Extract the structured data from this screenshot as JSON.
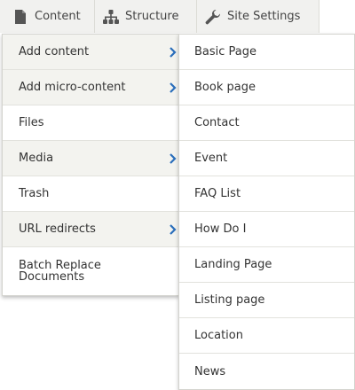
{
  "toolbar": {
    "tabs": [
      {
        "label": "Content",
        "icon": "file-icon"
      },
      {
        "label": "Structure",
        "icon": "sitemap-icon"
      },
      {
        "label": "Site Settings",
        "icon": "wrench-icon"
      }
    ]
  },
  "menu": {
    "items": [
      {
        "label": "Add content",
        "has_submenu": true
      },
      {
        "label": "Add micro-content",
        "has_submenu": true
      },
      {
        "label": "Files",
        "has_submenu": false
      },
      {
        "label": "Media",
        "has_submenu": true
      },
      {
        "label": "Trash",
        "has_submenu": false
      },
      {
        "label": "URL redirects",
        "has_submenu": true
      },
      {
        "label": "Batch Replace Documents",
        "has_submenu": false
      }
    ]
  },
  "submenu": {
    "items": [
      {
        "label": "Basic Page"
      },
      {
        "label": "Book page"
      },
      {
        "label": "Contact"
      },
      {
        "label": "Event"
      },
      {
        "label": "FAQ List"
      },
      {
        "label": "How Do I"
      },
      {
        "label": "Landing Page"
      },
      {
        "label": "Listing page"
      },
      {
        "label": "Location"
      },
      {
        "label": "News"
      }
    ]
  },
  "colors": {
    "chevron": "#2a6ebb",
    "icon": "#555555",
    "highlight_bg": "#f3f3ef"
  }
}
